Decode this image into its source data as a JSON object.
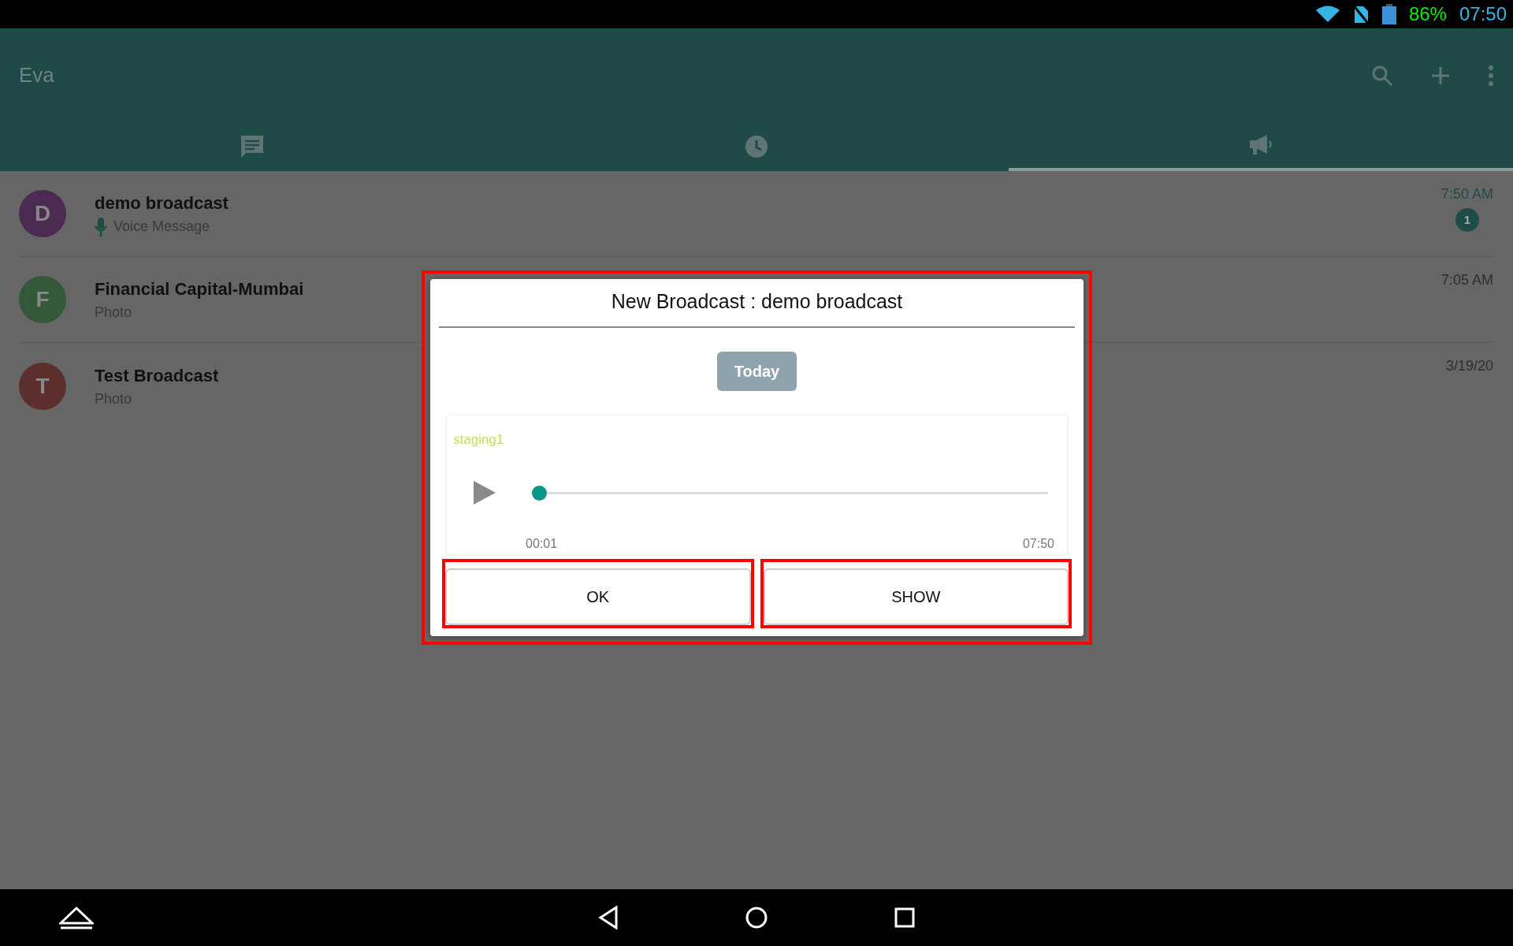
{
  "status_bar": {
    "battery": "86%",
    "time": "07:50"
  },
  "app_bar": {
    "title": "Eva"
  },
  "tabs": [
    {
      "kind": "chats",
      "selected": false
    },
    {
      "kind": "history",
      "selected": false
    },
    {
      "kind": "broadcasts",
      "selected": true
    }
  ],
  "conversations": [
    {
      "avatar_letter": "D",
      "color": "#4b2b52",
      "name": "demo broadcast",
      "kind": "voice",
      "preview": "Voice Message",
      "time": "7:50 AM",
      "unread": true,
      "unread_count": "1"
    },
    {
      "avatar_letter": "F",
      "color": "#35573a",
      "name": "Financial Capital-Mumbai",
      "kind": "text",
      "preview": "Photo",
      "time": "7:05 AM",
      "unread": false
    },
    {
      "avatar_letter": "T",
      "color": "#5c2f2e",
      "name": "Test Broadcast",
      "kind": "text",
      "preview": "Photo",
      "time": "3/19/20",
      "unread": false
    }
  ],
  "dialog": {
    "highlighted": true,
    "title": "New Broadcast : demo broadcast",
    "date_chip": "Today",
    "sender": "staging1",
    "player": {
      "playing": false,
      "level": 0,
      "elapsed": "00:01",
      "duration": "07:50"
    },
    "buttons": [
      {
        "label": "OK",
        "highlighted": true
      },
      {
        "label": "SHOW",
        "highlighted": true
      }
    ]
  }
}
